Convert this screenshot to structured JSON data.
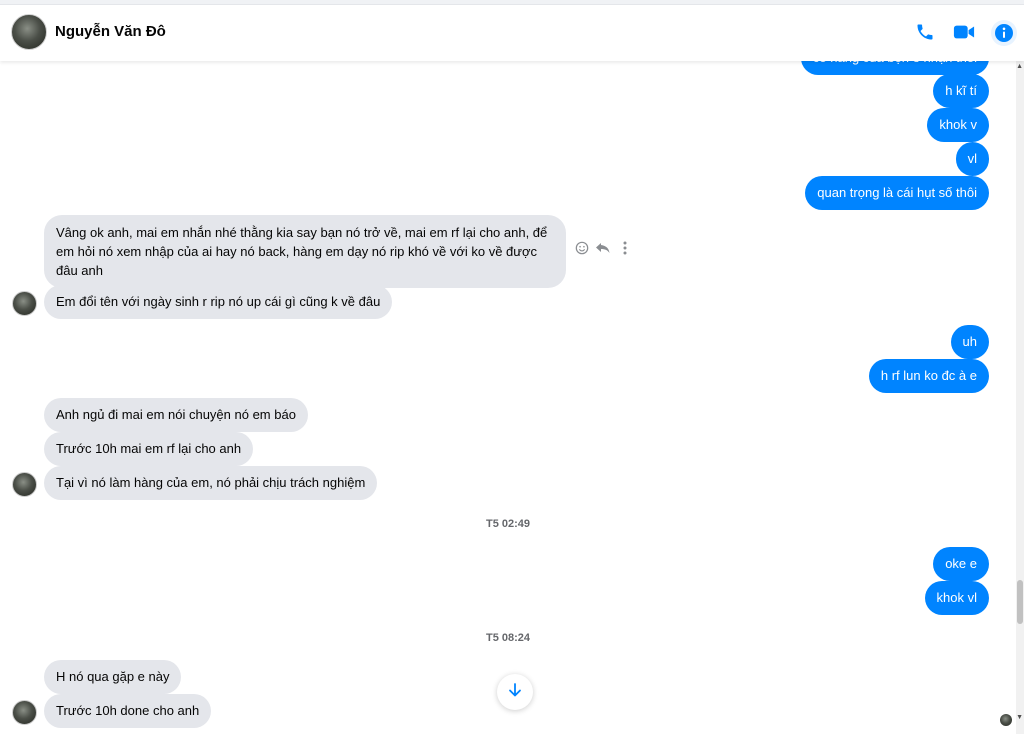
{
  "header": {
    "contact_name": "Nguyễn Văn Đô",
    "icons": [
      "phone-icon",
      "video-camera-icon",
      "info-icon"
    ],
    "accent_color": "#0084ff"
  },
  "messages": {
    "out_partial": "có hàng của bọn e nhận thôi",
    "out_1": "h kĩ tí",
    "out_2": "khok v",
    "out_3": "vl",
    "out_4": "quan trọng là cái hụt số thôi",
    "in_1": "Vâng ok anh, mai em nhắn nhé thằng kia say bạn nó trở về, mai em rf lại cho anh, để em hỏi nó xem nhập của ai hay nó back, hàng em dạy nó rip khó về với ko về được đâu anh",
    "in_2": "Em đổi tên với ngày sinh r rip nó up cái gì cũng k về đâu",
    "out_5": "uh",
    "out_6": "h rf lun ko đc à e",
    "in_3": "Anh ngủ đi mai em nói chuyện nó em báo",
    "in_4": "Trước 10h mai em rf lại cho anh",
    "in_5": "Tại vì nó làm hàng của em, nó phải chịu trách nghiệm",
    "ts_1": "T5 02:49",
    "out_7": "oke e",
    "out_8": "khok vl",
    "ts_2": "T5 08:24",
    "in_6": "H nó qua gặp e này",
    "in_7": "Trước 10h done cho anh"
  },
  "colors": {
    "outgoing_bubble": "#0084ff",
    "incoming_bubble": "#e4e6eb",
    "timestamp": "#65676b"
  }
}
